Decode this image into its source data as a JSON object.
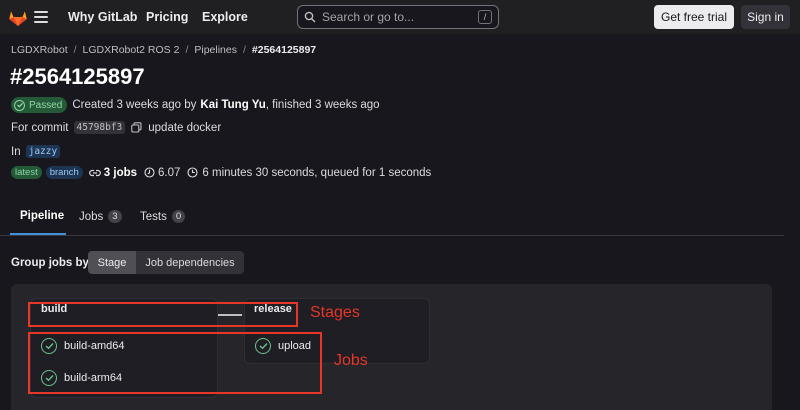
{
  "topbar": {
    "logo_icon": "gitlab-tanuki-icon",
    "menu_icon": "hamburger-menu-icon",
    "nav": [
      "Why GitLab",
      "Pricing",
      "Explore"
    ],
    "search_placeholder": "Search or go to...",
    "search_shortcut": "/",
    "trial_label": "Get free trial",
    "signin_label": "Sign in"
  },
  "breadcrumb": [
    "LGDXRobot",
    "LGDXRobot2 ROS 2",
    "Pipelines",
    "#2564125897"
  ],
  "page_title": "#2564125897",
  "status": {
    "badge": "Passed",
    "created_prefix": "Created 3 weeks ago by",
    "author": "Kai Tung Yu",
    "finished": ", finished 3 weeks ago"
  },
  "commit": {
    "prefix": "For commit",
    "sha": "45798bf3",
    "message": "update docker"
  },
  "branch": {
    "prefix": "In",
    "name": "jazzy"
  },
  "meta": {
    "tag_latest": "latest",
    "tag_branch": "branch",
    "jobs": "3 jobs",
    "compute": "6.07",
    "duration": "6 minutes 30 seconds, queued for 1 seconds"
  },
  "tabs": [
    {
      "label": "Pipeline"
    },
    {
      "label": "Jobs",
      "count": "3"
    },
    {
      "label": "Tests",
      "count": "0"
    }
  ],
  "group_jobs": {
    "label": "Group jobs by",
    "options": [
      "Stage",
      "Job dependencies"
    ],
    "selected": "Stage"
  },
  "stages": [
    {
      "name": "build",
      "jobs": [
        "build-amd64",
        "build-arm64"
      ]
    },
    {
      "name": "release",
      "jobs": [
        "upload"
      ]
    }
  ],
  "annotations": {
    "stages_label": "Stages",
    "jobs_label": "Jobs",
    "color": "#e53627"
  },
  "colors": {
    "background": "#18171d",
    "topbar": "#202023",
    "success": "#6bc28a",
    "tab_accent": "#428fdc"
  }
}
